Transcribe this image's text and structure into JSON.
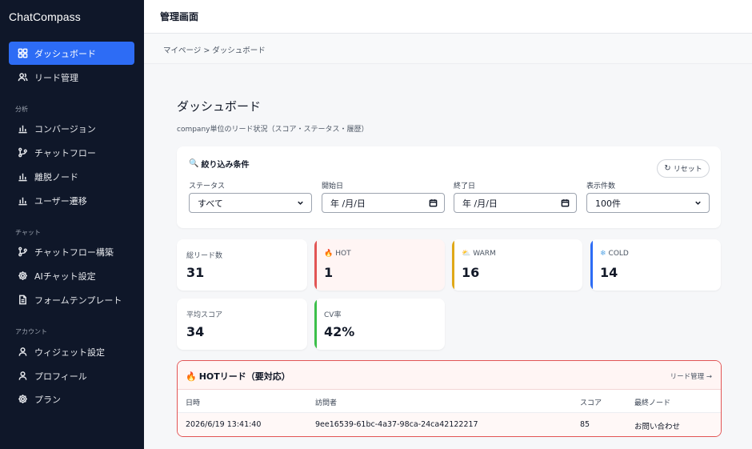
{
  "app": {
    "brand": "ChatCompass"
  },
  "sidebar": {
    "items_top": [
      {
        "label": "ダッシュボード",
        "icon": "grid-icon"
      },
      {
        "label": "リード管理",
        "icon": "users-icon"
      }
    ],
    "section_analysis": "分析",
    "items_analysis": [
      {
        "label": "コンバージョン",
        "icon": "bar-chart-icon"
      },
      {
        "label": "チャットフロー",
        "icon": "flow-icon"
      },
      {
        "label": "離脱ノード",
        "icon": "bar-chart-icon"
      },
      {
        "label": "ユーザー遷移",
        "icon": "bar-chart-icon"
      }
    ],
    "section_chat": "チャット",
    "items_chat": [
      {
        "label": "チャットフロー構築",
        "icon": "flow-icon"
      },
      {
        "label": "AIチャット設定",
        "icon": "gear-icon"
      },
      {
        "label": "フォームテンプレート",
        "icon": "document-icon"
      }
    ],
    "section_account": "アカウント",
    "items_account": [
      {
        "label": "ウィジェット設定",
        "icon": "user-icon"
      },
      {
        "label": "プロフィール",
        "icon": "user-icon"
      },
      {
        "label": "プラン",
        "icon": "gear-icon"
      }
    ]
  },
  "header": {
    "title": "管理画面"
  },
  "breadcrumb": "マイページ > ダッシュボード",
  "page": {
    "title": "ダッシュボード",
    "subtitle": "company単位のリード状況（スコア・ステータス・履歴）"
  },
  "filters": {
    "title": "絞り込み条件",
    "reset_label": "リセット",
    "status_label": "ステータス",
    "status_value": "すべて",
    "start_label": "開始日",
    "start_value": "年 /月/日",
    "end_label": "終了日",
    "end_value": "年 /月/日",
    "count_label": "表示件数",
    "count_value": "100件"
  },
  "stats": {
    "total": {
      "label": "総リード数",
      "value": "31"
    },
    "hot": {
      "label": "HOT",
      "value": "1",
      "color": "#e25555"
    },
    "warm": {
      "label": "WARM",
      "value": "16",
      "color": "#e0a817"
    },
    "cold": {
      "label": "COLD",
      "value": "14",
      "color": "#2d6cf5"
    },
    "avg_score": {
      "label": "平均スコア",
      "value": "34"
    },
    "cv_rate": {
      "label": "CV率",
      "value": "42%",
      "color": "#3bbf4a"
    }
  },
  "hot_leads": {
    "title": "HOTリード（要対応）",
    "link_label": "リード管理 →",
    "columns": [
      "日時",
      "訪問者",
      "スコア",
      "最終ノード"
    ],
    "rows": [
      [
        "2026/6/19 13:41:40",
        "9ee16539-61bc-4a37-98ca-24ca42122217",
        "85",
        "お問い合わせ"
      ]
    ]
  }
}
